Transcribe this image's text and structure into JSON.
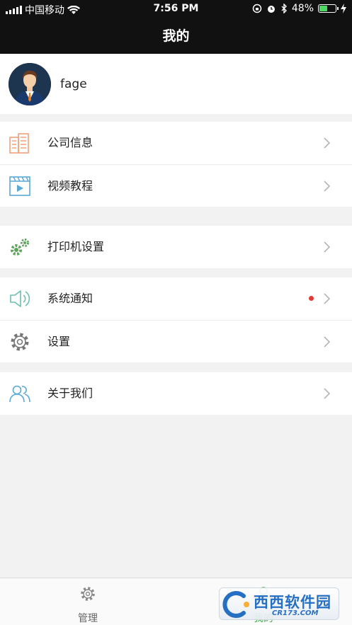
{
  "status_bar": {
    "carrier": "中国移动",
    "time": "7:56 PM",
    "battery": "48%",
    "battery_level": 0.48
  },
  "nav": {
    "title": "我的"
  },
  "profile": {
    "username": "fage"
  },
  "menu": {
    "company_info": "公司信息",
    "video_tutorial": "视频教程",
    "printer_settings": "打印机设置",
    "system_notice": "系统通知",
    "settings": "设置",
    "about_us": "关于我们"
  },
  "tabs": {
    "manage": "管理",
    "mine": "我的"
  },
  "watermark": {
    "title": "西西软件园",
    "sub": "CR173.COM"
  },
  "colors": {
    "active_tab": "#4caf50",
    "badge": "#e53935",
    "header": "#111111"
  }
}
